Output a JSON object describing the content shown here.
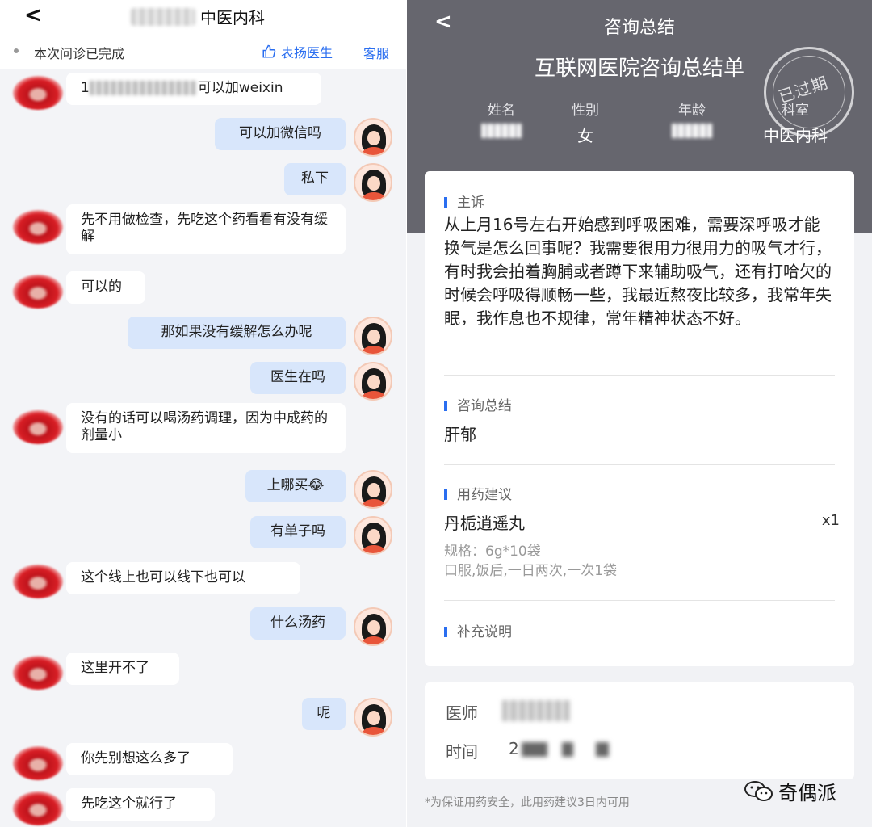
{
  "chat": {
    "back_icon": "chevron-left-icon",
    "title": "中医内科",
    "status": "本次问诊已完成",
    "praise_label": "表扬医生",
    "service_label": "客服",
    "messages": [
      {
        "from": "doctor",
        "text": "可以加weixin",
        "blurred_prefix": "1"
      },
      {
        "from": "patient",
        "text": "可以加微信吗"
      },
      {
        "from": "patient",
        "text": "私下"
      },
      {
        "from": "doctor",
        "text": "先不用做检查，先吃这个药看看有没有缓解"
      },
      {
        "from": "doctor",
        "text": "可以的"
      },
      {
        "from": "patient",
        "text": "那如果没有缓解怎么办呢"
      },
      {
        "from": "patient",
        "text": "医生在吗"
      },
      {
        "from": "doctor",
        "text": "没有的话可以喝汤药调理，因为中成药的剂量小"
      },
      {
        "from": "patient",
        "text": "上哪买😂"
      },
      {
        "from": "patient",
        "text": "有单子吗"
      },
      {
        "from": "doctor",
        "text": "这个线上也可以线下也可以"
      },
      {
        "from": "patient",
        "text": "什么汤药"
      },
      {
        "from": "doctor",
        "text": "这里开不了"
      },
      {
        "from": "patient",
        "text": "呢"
      },
      {
        "from": "doctor",
        "text": "你先别想这么多了"
      },
      {
        "from": "doctor",
        "text": "先吃这个就行了"
      }
    ]
  },
  "summary": {
    "page_title": "咨询总结",
    "doc_title": "互联网医院咨询总结单",
    "stamp_text": "已过期",
    "info_labels": {
      "name": "姓名",
      "gender": "性别",
      "age": "年龄",
      "dept": "科室"
    },
    "info_values": {
      "gender": "女",
      "dept": "中医内科"
    },
    "complaint_heading": "主诉",
    "complaint_text": "从上月16号左右开始感到呼吸困难，需要深呼吸才能换气是怎么回事呢？我需要很用力很用力的吸气才行，有时我会拍着胸脯或者蹲下来辅助吸气，还有打哈欠的时候会呼吸得顺畅一些，我最近熬夜比较多，我常年失眠，我作息也不规律，常年精神状态不好。",
    "consult_heading": "咨询总结",
    "diagnosis": "肝郁",
    "med_heading": "用药建议",
    "drug_name": "丹栀逍遥丸",
    "drug_qty": "x1",
    "spec": "规格：6g*10袋",
    "usage": "口服,饭后,一日两次,一次1袋",
    "extra_heading": "补充说明",
    "doctor_label": "医师",
    "time_label": "时间",
    "time_prefix": "2",
    "footnote": "*为保证用药安全，此用药建议3日内可用",
    "watermark": "奇偶派"
  },
  "colors": {
    "accent": "#2a6ef0",
    "header_bg": "#66666e",
    "patient_bubble": "#d8e6fb"
  }
}
